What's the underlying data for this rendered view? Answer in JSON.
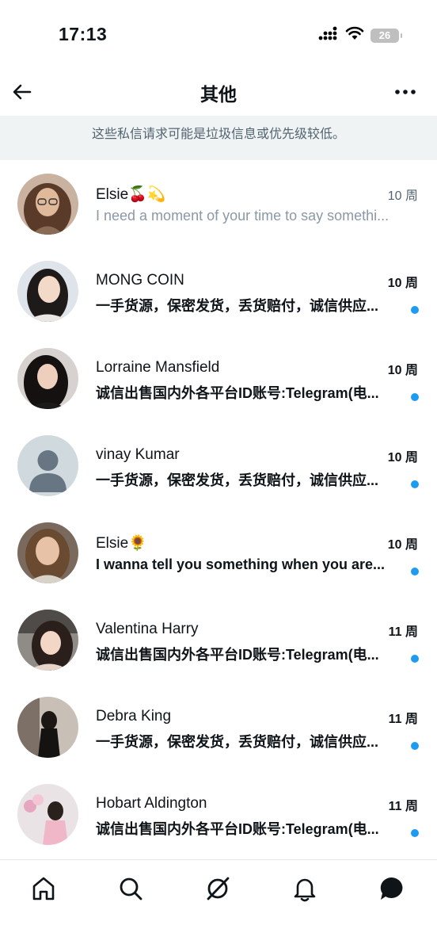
{
  "status": {
    "time": "17:13",
    "battery": "26"
  },
  "header": {
    "title": "其他"
  },
  "banner": {
    "text": "这些私信请求可能是垃圾信息或优先级较低。"
  },
  "messages": [
    {
      "name": "Elsie🍒💫",
      "time": "10 周",
      "preview": "I need a moment of your time to say somethi...",
      "unread": false
    },
    {
      "name": "MONG COIN",
      "time": "10 周",
      "preview": "一手货源，保密发货，丢货赔付，诚信供应...",
      "unread": true
    },
    {
      "name": "Lorraine Mansfield",
      "time": "10 周",
      "preview": "诚信出售国内外各平台ID账号:Telegram(电...",
      "unread": true
    },
    {
      "name": "vinay Kumar",
      "time": "10 周",
      "preview": "一手货源，保密发货，丢货赔付，诚信供应...",
      "unread": true
    },
    {
      "name": "Elsie🌻",
      "time": "10 周",
      "preview": "I wanna tell you something when you are...",
      "unread": true
    },
    {
      "name": "Valentina Harry",
      "time": "11 周",
      "preview": "诚信出售国内外各平台ID账号:Telegram(电...",
      "unread": true
    },
    {
      "name": "Debra King",
      "time": "11 周",
      "preview": "一手货源，保密发货，丢货赔付，诚信供应...",
      "unread": true
    },
    {
      "name": "Hobart Aldington",
      "time": "11 周",
      "preview": "诚信出售国内外各平台ID账号:Telegram(电...",
      "unread": true
    }
  ],
  "colors": {
    "unread_dot": "#1d9bf0",
    "banner_bg": "#eff3f4",
    "muted_text": "#536471"
  },
  "nav": {
    "icons": [
      "home-icon",
      "search-icon",
      "grok-icon",
      "bell-icon",
      "messages-icon"
    ]
  }
}
